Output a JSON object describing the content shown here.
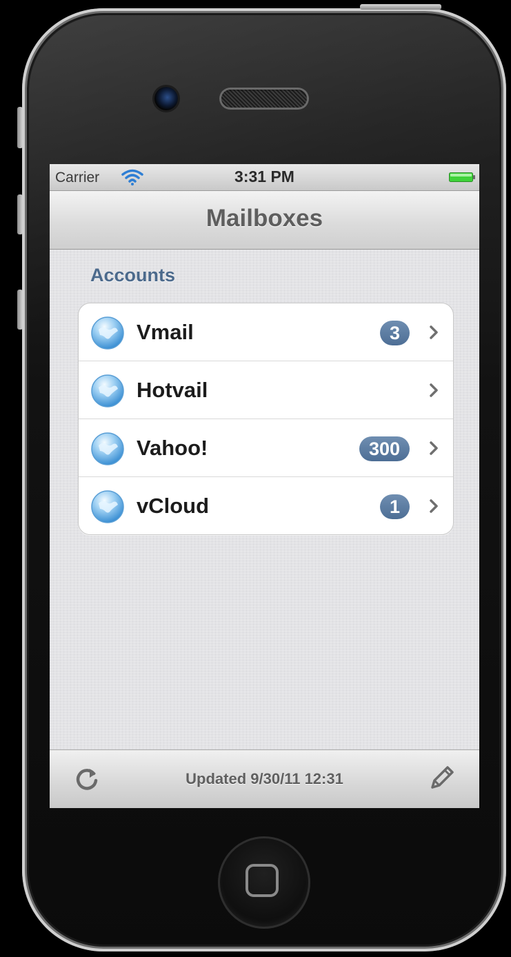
{
  "device": {
    "icons": {
      "camera": "front-camera-icon",
      "speaker": "earpiece-speaker-icon",
      "home": "home-button-icon"
    }
  },
  "status_bar": {
    "carrier": "Carrier",
    "time": "3:31 PM",
    "wifi_icon": "wifi-icon",
    "battery_icon": "battery-icon",
    "battery_color": "#3fd23a"
  },
  "nav": {
    "title": "Mailboxes"
  },
  "accounts": {
    "section_title": "Accounts",
    "items": [
      {
        "label": "Vmail",
        "badge": "3",
        "icon": "globe-icon"
      },
      {
        "label": "Hotvail",
        "badge": "",
        "icon": "globe-icon"
      },
      {
        "label": "Vahoo!",
        "badge": "300",
        "icon": "globe-icon"
      },
      {
        "label": "vCloud",
        "badge": "1",
        "icon": "globe-icon"
      }
    ]
  },
  "toolbar": {
    "updated_text": "Updated 9/30/11 12:31",
    "refresh_icon": "refresh-icon",
    "compose_icon": "compose-icon"
  },
  "colors": {
    "badge": "#5b7ba2",
    "section_header": "#4c6a8c"
  }
}
